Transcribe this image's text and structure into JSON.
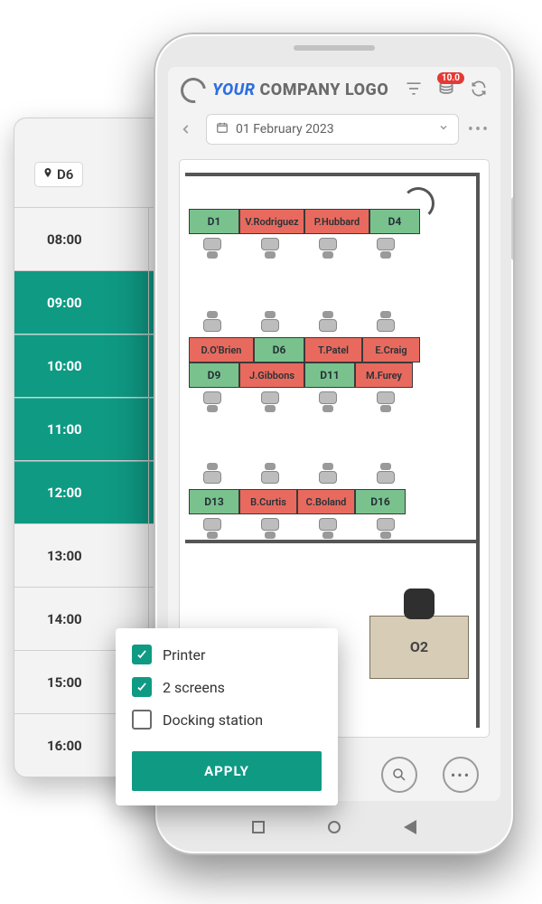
{
  "colors": {
    "teal": "#0f9a84",
    "green": "#79c28e",
    "red": "#e86a5e",
    "badge": "#e53935",
    "blue": "#2f6fe0"
  },
  "back_panel": {
    "selected_desk": "D6",
    "times": [
      "08:00",
      "09:00",
      "10:00",
      "11:00",
      "12:00",
      "13:00",
      "14:00",
      "15:00",
      "16:00"
    ],
    "selected_times": [
      "09:00",
      "10:00",
      "11:00",
      "12:00"
    ]
  },
  "header": {
    "logo_your": "YOUR",
    "logo_company": "COMPANY LOGO",
    "coin_badge": "10.0"
  },
  "datebar": {
    "date_text": "01 February 2023"
  },
  "floor": {
    "row1": [
      {
        "label": "D1",
        "status": "green"
      },
      {
        "label": "V.Rodriguez",
        "status": "red"
      },
      {
        "label": "P.Hubbard",
        "status": "red"
      },
      {
        "label": "D4",
        "status": "green"
      }
    ],
    "row2a": [
      {
        "label": "D.O'Brien",
        "status": "red"
      },
      {
        "label": "D6",
        "status": "green"
      },
      {
        "label": "T.Patel",
        "status": "red"
      },
      {
        "label": "E.Craig",
        "status": "red"
      }
    ],
    "row2b": [
      {
        "label": "D9",
        "status": "green"
      },
      {
        "label": "J.Gibbons",
        "status": "red"
      },
      {
        "label": "D11",
        "status": "green"
      },
      {
        "label": "M.Furey",
        "status": "red"
      }
    ],
    "row3": [
      {
        "label": "D13",
        "status": "green"
      },
      {
        "label": "B.Curtis",
        "status": "red"
      },
      {
        "label": "C.Boland",
        "status": "red"
      },
      {
        "label": "D16",
        "status": "green"
      }
    ],
    "office_label": "O2"
  },
  "popover": {
    "options": [
      {
        "label": "Printer",
        "checked": true
      },
      {
        "label": "2 screens",
        "checked": true
      },
      {
        "label": "Docking station",
        "checked": false
      }
    ],
    "apply_label": "APPLY"
  }
}
